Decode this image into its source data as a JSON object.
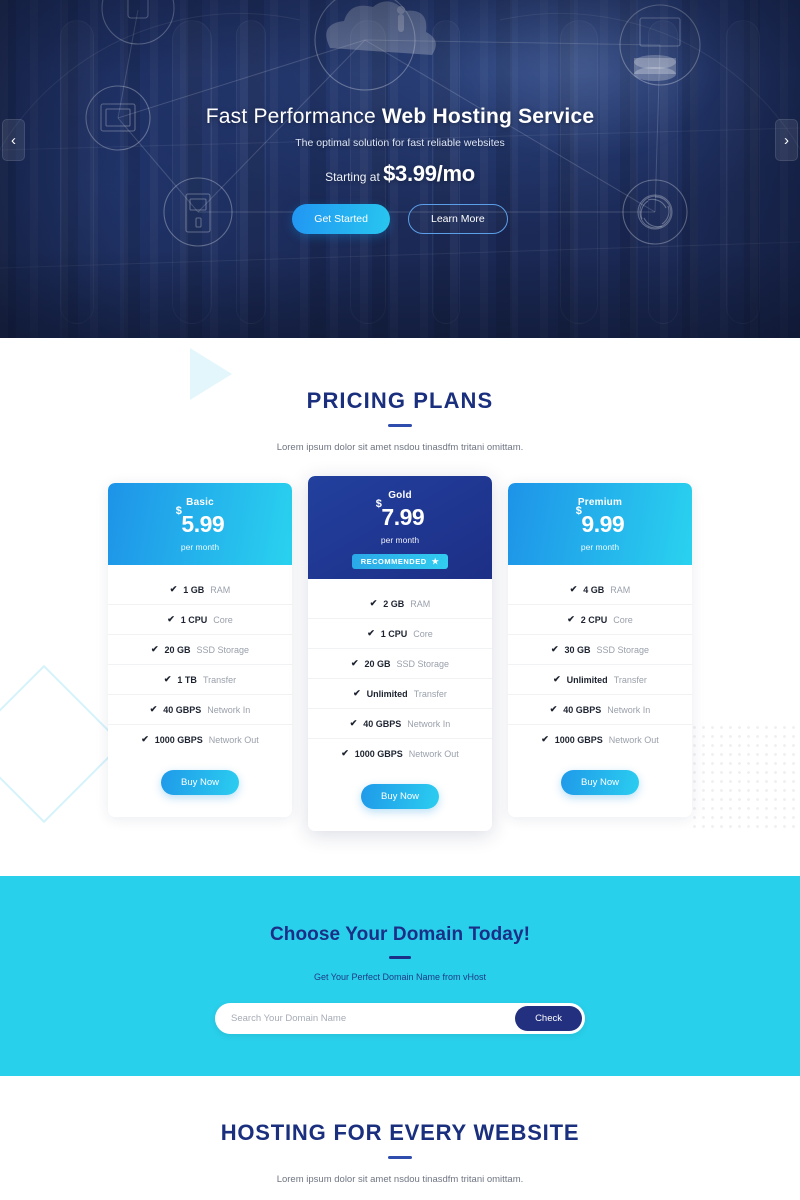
{
  "hero": {
    "title_light": "Fast Performance ",
    "title_bold": "Web Hosting Service",
    "subtitle": "The optimal solution for fast reliable websites",
    "price_prefix": "Starting at ",
    "price": "$3.99/mo",
    "primary_button": "Get Started",
    "secondary_button": "Learn More",
    "prev_arrow": "‹",
    "next_arrow": "›"
  },
  "pricing": {
    "title": "PRICING PLANS",
    "subtitle": "Lorem ipsum dolor sit amet nsdou tinasdfm tritani omittam.",
    "plans": [
      {
        "name": "Basic",
        "currency": "$",
        "price": "5.99",
        "period": "per month",
        "badge": null,
        "features": [
          {
            "value": "1 GB",
            "label": "RAM"
          },
          {
            "value": "1 CPU",
            "label": "Core"
          },
          {
            "value": "20 GB",
            "label": "SSD Storage"
          },
          {
            "value": "1 TB",
            "label": "Transfer"
          },
          {
            "value": "40 GBPS",
            "label": "Network In"
          },
          {
            "value": "1000 GBPS",
            "label": "Network Out"
          }
        ],
        "cta": "Buy Now"
      },
      {
        "name": "Gold",
        "currency": "$",
        "price": "7.99",
        "period": "per month",
        "badge": "RECOMMENDED",
        "badge_star": "★",
        "features": [
          {
            "value": "2 GB",
            "label": "RAM"
          },
          {
            "value": "1 CPU",
            "label": "Core"
          },
          {
            "value": "20 GB",
            "label": "SSD Storage"
          },
          {
            "value": "Unlimited",
            "label": "Transfer"
          },
          {
            "value": "40 GBPS",
            "label": "Network In"
          },
          {
            "value": "1000 GBPS",
            "label": "Network Out"
          }
        ],
        "cta": "Buy Now"
      },
      {
        "name": "Premium",
        "currency": "$",
        "price": "9.99",
        "period": "per month",
        "badge": null,
        "features": [
          {
            "value": "4 GB",
            "label": "RAM"
          },
          {
            "value": "2 CPU",
            "label": "Core"
          },
          {
            "value": "30 GB",
            "label": "SSD Storage"
          },
          {
            "value": "Unlimited",
            "label": "Transfer"
          },
          {
            "value": "40 GBPS",
            "label": "Network In"
          },
          {
            "value": "1000 GBPS",
            "label": "Network Out"
          }
        ],
        "cta": "Buy Now"
      }
    ],
    "check_glyph": "✔"
  },
  "domain": {
    "title_part1": "Choose Your ",
    "title_bold": "Domain",
    "title_part2": " Today!",
    "subtitle": "Get Your Perfect Domain Name from vHost",
    "search_placeholder": "Search Your Domain Name",
    "search_value": "",
    "check_button": "Check"
  },
  "bottom": {
    "title": "HOSTING FOR EVERY WEBSITE",
    "subtitle": "Lorem ipsum dolor sit amet nsdou tinasdfm tritani omittam."
  },
  "colors": {
    "navy": "#1a2f7e",
    "cyan": "#29d0eb",
    "accent_blue": "#1e93e8",
    "gold_card": "#22409e"
  }
}
